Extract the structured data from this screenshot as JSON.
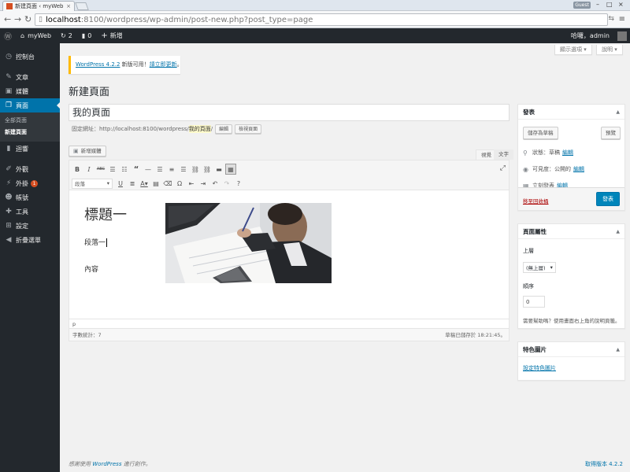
{
  "browser": {
    "tab_title": "新建頁面 ‹ myWeb — W",
    "tab_close": "×",
    "guest_label": "Guest",
    "url_host": "localhost",
    "url_path": ":8100/wordpress/wp-admin/post-new.php?post_type=page"
  },
  "adminbar": {
    "site_name": "myWeb",
    "updates_count": "2",
    "comments_count": "0",
    "new_label": "新增",
    "greeting": "哈囉，admin"
  },
  "sidebar": {
    "items": [
      {
        "label": "控制台"
      },
      {
        "label": "文章"
      },
      {
        "label": "媒體"
      },
      {
        "label": "頁面"
      },
      {
        "label": "迴響"
      },
      {
        "label": "外觀"
      },
      {
        "label": "外掛",
        "badge": "1"
      },
      {
        "label": "帳號"
      },
      {
        "label": "工具"
      },
      {
        "label": "設定"
      },
      {
        "label": "折疊選單"
      }
    ],
    "submenu": [
      "全部頁面",
      "新建頁面"
    ]
  },
  "screen_options": {
    "display": "顯示選項 ▾",
    "help": "說明 ▾"
  },
  "notice": {
    "link": "WordPress 4.2.2",
    "text": " 新版可用！",
    "update_link": "請立即更新",
    "end": "。"
  },
  "page_title": "新建頁面",
  "post_title": "我的頁面",
  "permalink": {
    "label": "固定網址：",
    "base": "http://localhost:8100/wordpress/",
    "slug": "我的頁面",
    "slash": "/",
    "edit_btn": "編輯",
    "view_btn": "檢視頁面"
  },
  "editor": {
    "add_media": "新增媒體",
    "tab_visual": "視覺",
    "tab_text": "文字",
    "format_select": "段落",
    "heading": "標題一",
    "paragraph": "段落一",
    "body": "內容",
    "path": "p",
    "word_count": "字數統計：7",
    "draft_saved": "草稿已儲存於 18:21:45。"
  },
  "publish_box": {
    "title": "發表",
    "save_draft": "儲存為草稿",
    "preview": "預覽",
    "status_label": "狀態：草稿",
    "visibility_label": "可見度：公開的",
    "schedule_label": "立刻發表",
    "edit_link": "編輯",
    "trash": "移至回收桶",
    "publish": "發表"
  },
  "attributes_box": {
    "title": "頁面屬性",
    "parent_label": "上層",
    "parent_value": "(無上層)",
    "order_label": "順序",
    "order_value": "0",
    "help_text": "需要幫助嗎？使用畫面右上角的說明頁籤。"
  },
  "featured_box": {
    "title": "特色圖片",
    "set_link": "設定特色圖片"
  },
  "footer": {
    "thanks_pre": "感謝使用 ",
    "thanks_link": "WordPress",
    "thanks_post": " 進行創作。",
    "version": "取得版本 4.2.2"
  },
  "colors": {
    "admin_dark": "#23282d",
    "accent": "#0073aa",
    "publish_blue": "#0085ba",
    "notice_yellow": "#ffba00",
    "badge_orange": "#d54e21"
  }
}
